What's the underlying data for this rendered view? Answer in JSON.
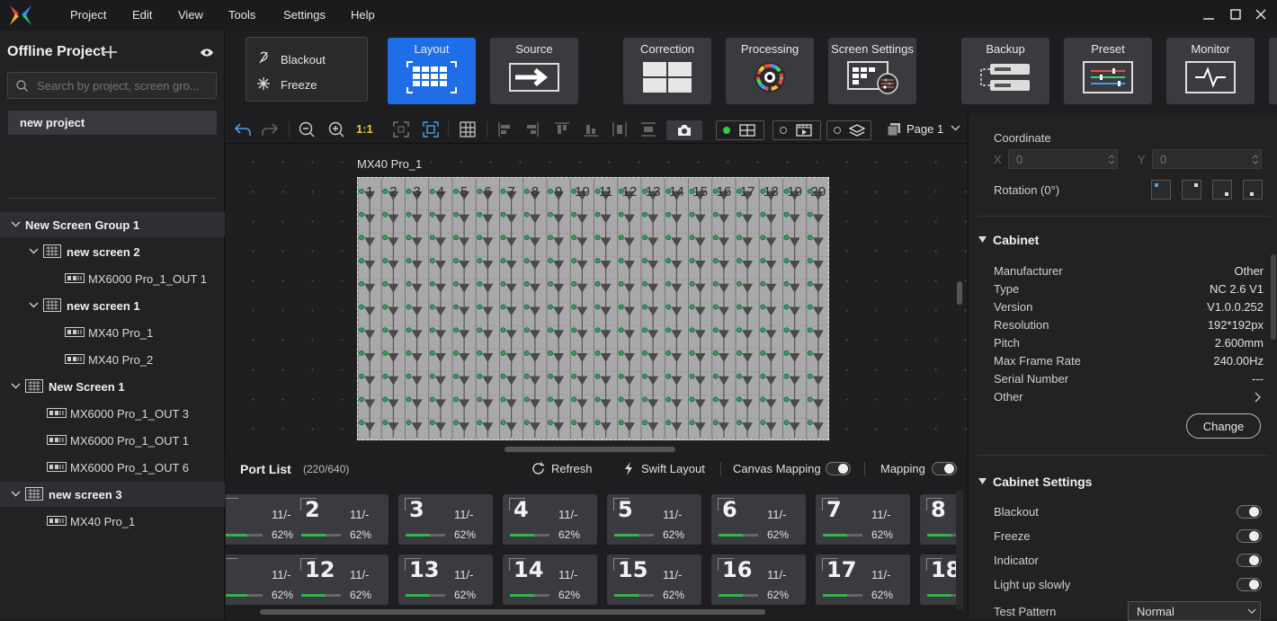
{
  "menu": {
    "items": [
      "Project",
      "Edit",
      "View",
      "Tools",
      "Settings",
      "Help"
    ]
  },
  "sidebar": {
    "title": "Offline Project",
    "search_placeholder": "Search by project, screen gro...",
    "project": "new project",
    "tree": [
      {
        "label": "New Screen Group 1",
        "level": 0,
        "type": "group"
      },
      {
        "label": "new screen 2",
        "level": 1,
        "type": "screen"
      },
      {
        "label": "MX6000 Pro_1_OUT 1",
        "level": 2,
        "type": "device"
      },
      {
        "label": "new screen 1",
        "level": 1,
        "type": "screen"
      },
      {
        "label": "MX40 Pro_1",
        "level": 2,
        "type": "device"
      },
      {
        "label": "MX40 Pro_2",
        "level": 2,
        "type": "device"
      },
      {
        "label": "New Screen 1",
        "level": 0,
        "type": "screen"
      },
      {
        "label": "MX6000 Pro_1_OUT 3",
        "level": 1,
        "type": "device"
      },
      {
        "label": "MX6000 Pro_1_OUT 1",
        "level": 1,
        "type": "device"
      },
      {
        "label": "MX6000 Pro_1_OUT 6",
        "level": 1,
        "type": "device"
      },
      {
        "label": "new screen 3",
        "level": 0,
        "type": "screen"
      },
      {
        "label": "MX40 Pro_1",
        "level": 1,
        "type": "device"
      }
    ]
  },
  "toolbar": {
    "blackout": "Blackout",
    "freeze": "Freeze",
    "tabs": [
      "Layout",
      "Source",
      "Correction",
      "Processing",
      "Screen Settings",
      "Backup",
      "Preset",
      "Monitor"
    ],
    "active_tab": "Layout",
    "accent": "#1f6ee8"
  },
  "canvasbar": {
    "zoom_label": "1:1",
    "page": "Page 1"
  },
  "canvas": {
    "screen_label": "MX40 Pro_1",
    "columns": [
      "1",
      "2",
      "3",
      "4",
      "5",
      "6",
      "7",
      "8",
      "9",
      "10",
      "11",
      "12",
      "13",
      "14",
      "15",
      "16",
      "17",
      "18",
      "19",
      "20"
    ],
    "rows": 11
  },
  "ports": {
    "title": "Port List",
    "count": "(220/640)",
    "refresh": "Refresh",
    "swift": "Swift Layout",
    "canvas_mapping": "Canvas Mapping",
    "mapping": "Mapping",
    "row1": [
      "",
      "2",
      "3",
      "4",
      "5",
      "6",
      "7",
      "8"
    ],
    "row2": [
      "",
      "12",
      "13",
      "14",
      "15",
      "16",
      "17",
      "18"
    ],
    "count_label": "11/-",
    "percent_label": "62%",
    "percent": 0.62
  },
  "props": {
    "coordinate": "Coordinate",
    "x_label": "X",
    "x_value": "0",
    "y_label": "Y",
    "y_value": "0",
    "rotation": "Rotation (0°)",
    "cabinet_title": "Cabinet",
    "cabinet": [
      {
        "k": "Manufacturer",
        "v": "Other"
      },
      {
        "k": "Type",
        "v": "NC 2.6 V1"
      },
      {
        "k": "Version",
        "v": "V1.0.0.252"
      },
      {
        "k": "Resolution",
        "v": "192*192px"
      },
      {
        "k": "Pitch",
        "v": "2.600mm"
      },
      {
        "k": "Max Frame Rate",
        "v": "240.00Hz"
      },
      {
        "k": "Serial Number",
        "v": "---"
      },
      {
        "k": "Other",
        "v": ""
      }
    ],
    "change": "Change",
    "settings_title": "Cabinet Settings",
    "settings": [
      "Blackout",
      "Freeze",
      "Indicator",
      "Light up slowly"
    ],
    "test_pattern_label": "Test Pattern",
    "test_pattern_value": "Normal"
  }
}
